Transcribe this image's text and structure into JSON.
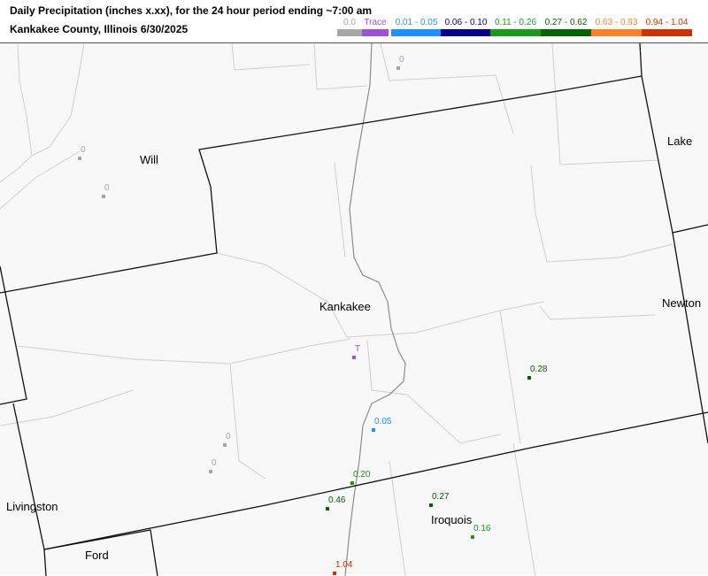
{
  "header": {
    "title_line1": "Daily Precipitation (inches  x.xx),  for the 24 hour period ending ~7:00 am",
    "title_line2": "Kankakee County, Illinois  6/30/2025"
  },
  "legend": [
    {
      "label": "0.0",
      "color": "#a6a6a6"
    },
    {
      "label": "Trace",
      "color": "#9b51d9"
    },
    {
      "label": "0.01 - 0.05",
      "color": "#1e90ff"
    },
    {
      "label": "0.06 - 0.10",
      "color": "#00008b"
    },
    {
      "label": "0.11 - 0.26",
      "color": "#1a9a1a"
    },
    {
      "label": "0.27 - 0.62",
      "color": "#006400"
    },
    {
      "label": "0.63 - 0.93",
      "color": "#ff7f2a"
    },
    {
      "label": "0.94 - 1.04",
      "color": "#cc3300"
    }
  ],
  "counties": [
    {
      "name": "Will"
    },
    {
      "name": "Kankakee"
    },
    {
      "name": "Lake"
    },
    {
      "name": "Newton"
    },
    {
      "name": "Livingston"
    },
    {
      "name": "Iroquois"
    },
    {
      "name": "Ford"
    }
  ],
  "stations": [
    {
      "value": "0",
      "color": "#a6a6a6"
    },
    {
      "value": "0",
      "color": "#a6a6a6"
    },
    {
      "value": "0",
      "color": "#a6a6a6"
    },
    {
      "value": "T",
      "color": "#9b51d9"
    },
    {
      "value": "0.28",
      "color": "#006400"
    },
    {
      "value": "0.05",
      "color": "#1e90ff"
    },
    {
      "value": "0",
      "color": "#a6a6a6"
    },
    {
      "value": "0",
      "color": "#a6a6a6"
    },
    {
      "value": "0.20",
      "color": "#1a9a1a"
    },
    {
      "value": "0.46",
      "color": "#006400"
    },
    {
      "value": "0.27",
      "color": "#006400"
    },
    {
      "value": "0.16",
      "color": "#1a9a1a"
    },
    {
      "value": "1.04",
      "color": "#cc3300"
    }
  ]
}
